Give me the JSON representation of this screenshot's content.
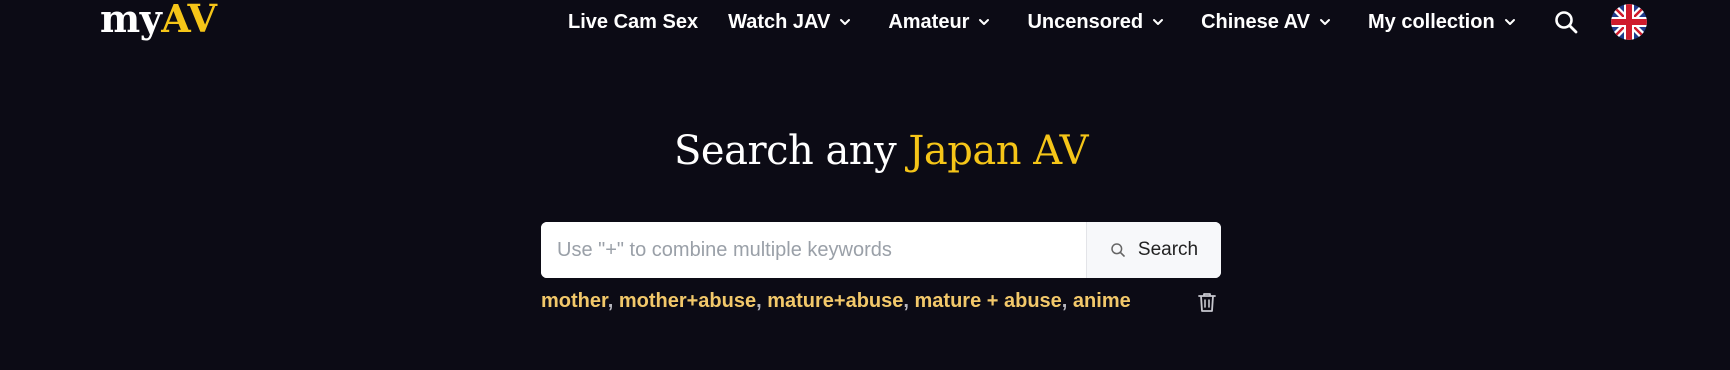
{
  "logo": {
    "part1": "my",
    "part2": "AV"
  },
  "nav": {
    "items": [
      {
        "label": "Live Cam Sex"
      },
      {
        "label": "Watch JAV"
      },
      {
        "label": "Amateur"
      },
      {
        "label": "Uncensored"
      },
      {
        "label": "Chinese AV"
      },
      {
        "label": "My collection"
      }
    ]
  },
  "hero": {
    "title_part1": "Search any ",
    "title_accent": "Japan AV"
  },
  "search": {
    "placeholder": "Use \"+\" to combine multiple keywords",
    "value": "",
    "button_label": "Search"
  },
  "history": {
    "items": [
      "mother",
      "mother+abuse",
      "mature+abuse",
      "mature + abuse",
      "anime"
    ],
    "separator": ", "
  },
  "colors": {
    "background": "#0c0b15",
    "accent": "#f5c518",
    "history_link": "#f2c86a"
  },
  "icons": {
    "chevron": "chevron-down-icon",
    "search": "search-icon",
    "language": "uk-flag-icon",
    "clear": "trash-icon"
  }
}
